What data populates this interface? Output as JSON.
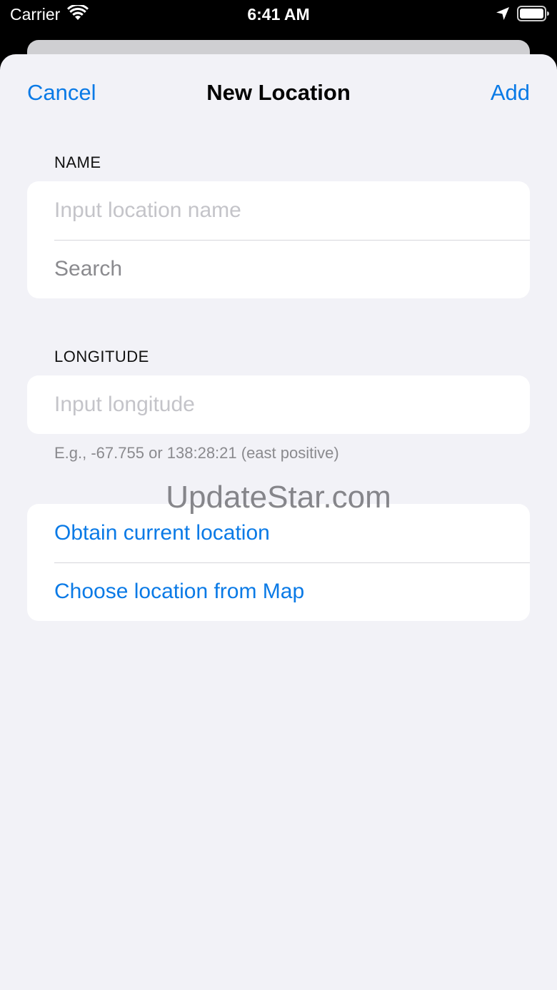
{
  "status_bar": {
    "carrier": "Carrier",
    "time": "6:41 AM"
  },
  "nav": {
    "cancel": "Cancel",
    "title": "New Location",
    "add": "Add"
  },
  "name_section": {
    "header": "NAME",
    "name_placeholder": "Input location name",
    "search_label": "Search"
  },
  "longitude_section": {
    "header": "LONGITUDE",
    "placeholder": "Input longitude",
    "footer": "E.g., -67.755 or 138:28:21 (east positive)"
  },
  "actions": {
    "obtain_current": "Obtain current location",
    "choose_from_map": "Choose location from Map"
  },
  "watermark": "UpdateStar.com",
  "colors": {
    "accent": "#0a7ae6",
    "background": "#f2f2f7",
    "placeholder": "#c4c4c9"
  },
  "icons": [
    "wifi-icon",
    "location-arrow-icon",
    "battery-icon"
  ]
}
